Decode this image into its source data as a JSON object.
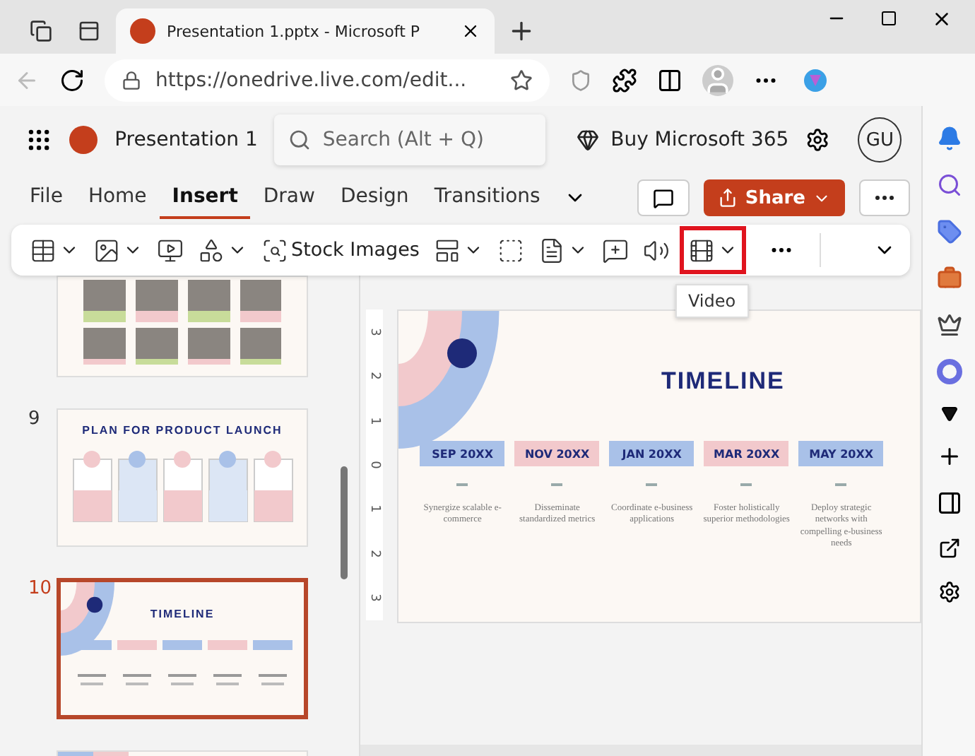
{
  "browser": {
    "tab_title": "Presentation 1.pptx - Microsoft P",
    "url": "https://onedrive.live.com/edit..."
  },
  "app": {
    "doc_title": "Presentation 1",
    "search_placeholder": "Search (Alt + Q)",
    "buy_label": "Buy Microsoft 365",
    "avatar": "GU",
    "share_label": "Share"
  },
  "tabs": [
    {
      "label": "File",
      "selected": false
    },
    {
      "label": "Home",
      "selected": false
    },
    {
      "label": "Insert",
      "selected": true
    },
    {
      "label": "Draw",
      "selected": false
    },
    {
      "label": "Design",
      "selected": false
    },
    {
      "label": "Transitions",
      "selected": false
    }
  ],
  "ribbon": [
    {
      "kind": "table",
      "caret": true,
      "highlighted": false
    },
    {
      "kind": "picture",
      "caret": true,
      "highlighted": false
    },
    {
      "kind": "screen",
      "caret": false,
      "highlighted": false
    },
    {
      "kind": "shapes",
      "caret": true,
      "highlighted": false
    },
    {
      "kind": "stock",
      "label": "Stock Images",
      "caret": false,
      "highlighted": false
    },
    {
      "kind": "layout",
      "caret": true,
      "highlighted": false
    },
    {
      "kind": "textbox",
      "caret": false,
      "highlighted": false
    },
    {
      "kind": "file",
      "caret": true,
      "highlighted": false
    },
    {
      "kind": "comment",
      "caret": false,
      "highlighted": false
    },
    {
      "kind": "audio",
      "caret": false,
      "highlighted": false
    },
    {
      "kind": "video",
      "caret": true,
      "highlighted": true,
      "tooltip": "Video"
    }
  ],
  "slides": [
    {
      "kind": "team",
      "selected": false
    },
    {
      "number": "9",
      "kind": "plan",
      "title": "PLAN FOR PRODUCT LAUNCH",
      "selected": false
    },
    {
      "number": "10",
      "kind": "timeline",
      "title": "TIMELINE",
      "selected": true
    },
    {
      "kind": "cut",
      "selected": false
    }
  ],
  "ruler_labels": [
    "3",
    "2",
    "1",
    "0",
    "1",
    "2",
    "3"
  ],
  "slide": {
    "title": "TIMELINE",
    "milestones": [
      {
        "date": "SEP 20XX",
        "description": "Synergize scalable e-commerce",
        "color": "#a9c1e8"
      },
      {
        "date": "NOV 20XX",
        "description": "Disseminate standardized metrics",
        "color": "#f2c9cc"
      },
      {
        "date": "JAN 20XX",
        "description": "Coordinate e-business applications",
        "color": "#a9c1e8"
      },
      {
        "date": "MAR 20XX",
        "description": "Foster holistically superior methodologies",
        "color": "#f2c9cc"
      },
      {
        "date": "MAY 20XX",
        "description": "Deploy strategic networks with compelling e-business needs",
        "color": "#a9c1e8"
      }
    ]
  }
}
